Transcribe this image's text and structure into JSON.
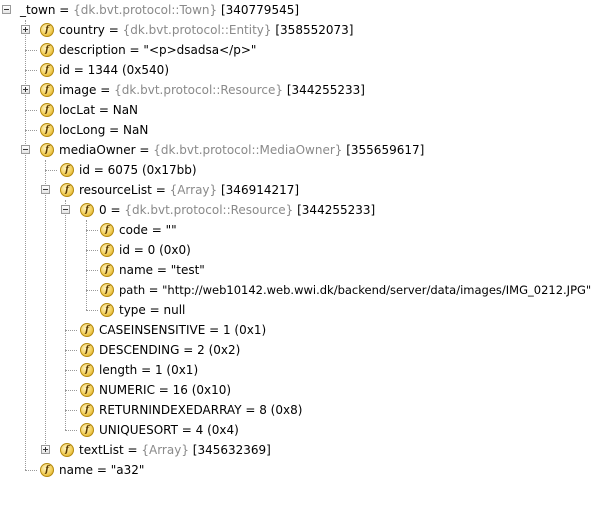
{
  "tree": {
    "root": {
      "name": "_town",
      "eq": " = ",
      "type": "{dk.bvt.protocol::Town}",
      "ref": " [340779545]"
    },
    "country": {
      "name": "country",
      "eq": " = ",
      "type": "{dk.bvt.protocol::Entity}",
      "ref": " [358552073]"
    },
    "description": {
      "name": "description",
      "eq": " = ",
      "value": "\"<p>dsadsa</p>\""
    },
    "id": {
      "name": "id",
      "eq": " = ",
      "value": "1344 (0x540)"
    },
    "image": {
      "name": "image",
      "eq": " = ",
      "type": "{dk.bvt.protocol::Resource}",
      "ref": " [344255233]"
    },
    "locLat": {
      "name": "locLat",
      "eq": " = ",
      "value": "NaN"
    },
    "locLong": {
      "name": "locLong",
      "eq": " = ",
      "value": "NaN"
    },
    "mediaOwner": {
      "name": "mediaOwner",
      "eq": " = ",
      "type": "{dk.bvt.protocol::MediaOwner}",
      "ref": " [355659617]"
    },
    "mo_id": {
      "name": "id",
      "eq": " = ",
      "value": "6075 (0x17bb)"
    },
    "resourceList": {
      "name": "resourceList",
      "eq": " = ",
      "type": "{Array}",
      "ref": " [346914217]"
    },
    "item0": {
      "name": "0",
      "eq": " = ",
      "type": "{dk.bvt.protocol::Resource}",
      "ref": " [344255233]"
    },
    "code": {
      "name": "code",
      "eq": " = ",
      "value": "\"\""
    },
    "r_id": {
      "name": "id",
      "eq": " = ",
      "value": "0 (0x0)"
    },
    "r_name": {
      "name": "name",
      "eq": " = ",
      "value": "\"test\""
    },
    "path": {
      "name": "path",
      "eq": " = ",
      "value": "\"http://web10142.web.wwi.dk/backend/server/data/images/IMG_0212.JPG\""
    },
    "type": {
      "name": "type",
      "eq": " = ",
      "value": "null"
    },
    "caseins": {
      "name": "CASEINSENSITIVE",
      "eq": " = ",
      "value": "1 (0x1)"
    },
    "desc": {
      "name": "DESCENDING",
      "eq": " = ",
      "value": "2 (0x2)"
    },
    "length": {
      "name": "length",
      "eq": " = ",
      "value": "1 (0x1)"
    },
    "numeric": {
      "name": "NUMERIC",
      "eq": " = ",
      "value": "16 (0x10)"
    },
    "retidx": {
      "name": "RETURNINDEXEDARRAY",
      "eq": " = ",
      "value": "8 (0x8)"
    },
    "uniq": {
      "name": "UNIQUESORT",
      "eq": " = ",
      "value": "4 (0x4)"
    },
    "textList": {
      "name": "textList",
      "eq": " = ",
      "type": "{Array}",
      "ref": " [345632369]"
    },
    "town_name": {
      "name": "name",
      "eq": " = ",
      "value": "\"a32\""
    }
  },
  "icons": {
    "field_icon_letter": "f",
    "field_icon_color": "#f2cc52"
  }
}
